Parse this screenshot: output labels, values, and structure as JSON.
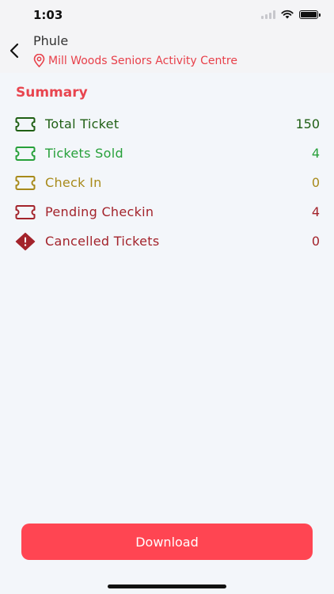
{
  "status_bar": {
    "time": "1:03"
  },
  "header": {
    "title": "Phule",
    "venue": "Mill Woods Seniors Activity Centre"
  },
  "summary": {
    "title": "Summary",
    "items": [
      {
        "label": "Total Ticket",
        "value": "150",
        "color": "#1f5f14",
        "icon": "ticket-icon"
      },
      {
        "label": "Tickets Sold",
        "value": "4",
        "color": "#27a03a",
        "icon": "ticket-icon"
      },
      {
        "label": "Check In",
        "value": "0",
        "color": "#a88a1a",
        "icon": "ticket-icon"
      },
      {
        "label": "Pending Checkin",
        "value": "4",
        "color": "#a3232b",
        "icon": "ticket-icon"
      },
      {
        "label": "Cancelled Tickets",
        "value": "0",
        "color": "#a3232b",
        "icon": "alert-diamond-icon"
      }
    ]
  },
  "actions": {
    "download_label": "Download"
  }
}
